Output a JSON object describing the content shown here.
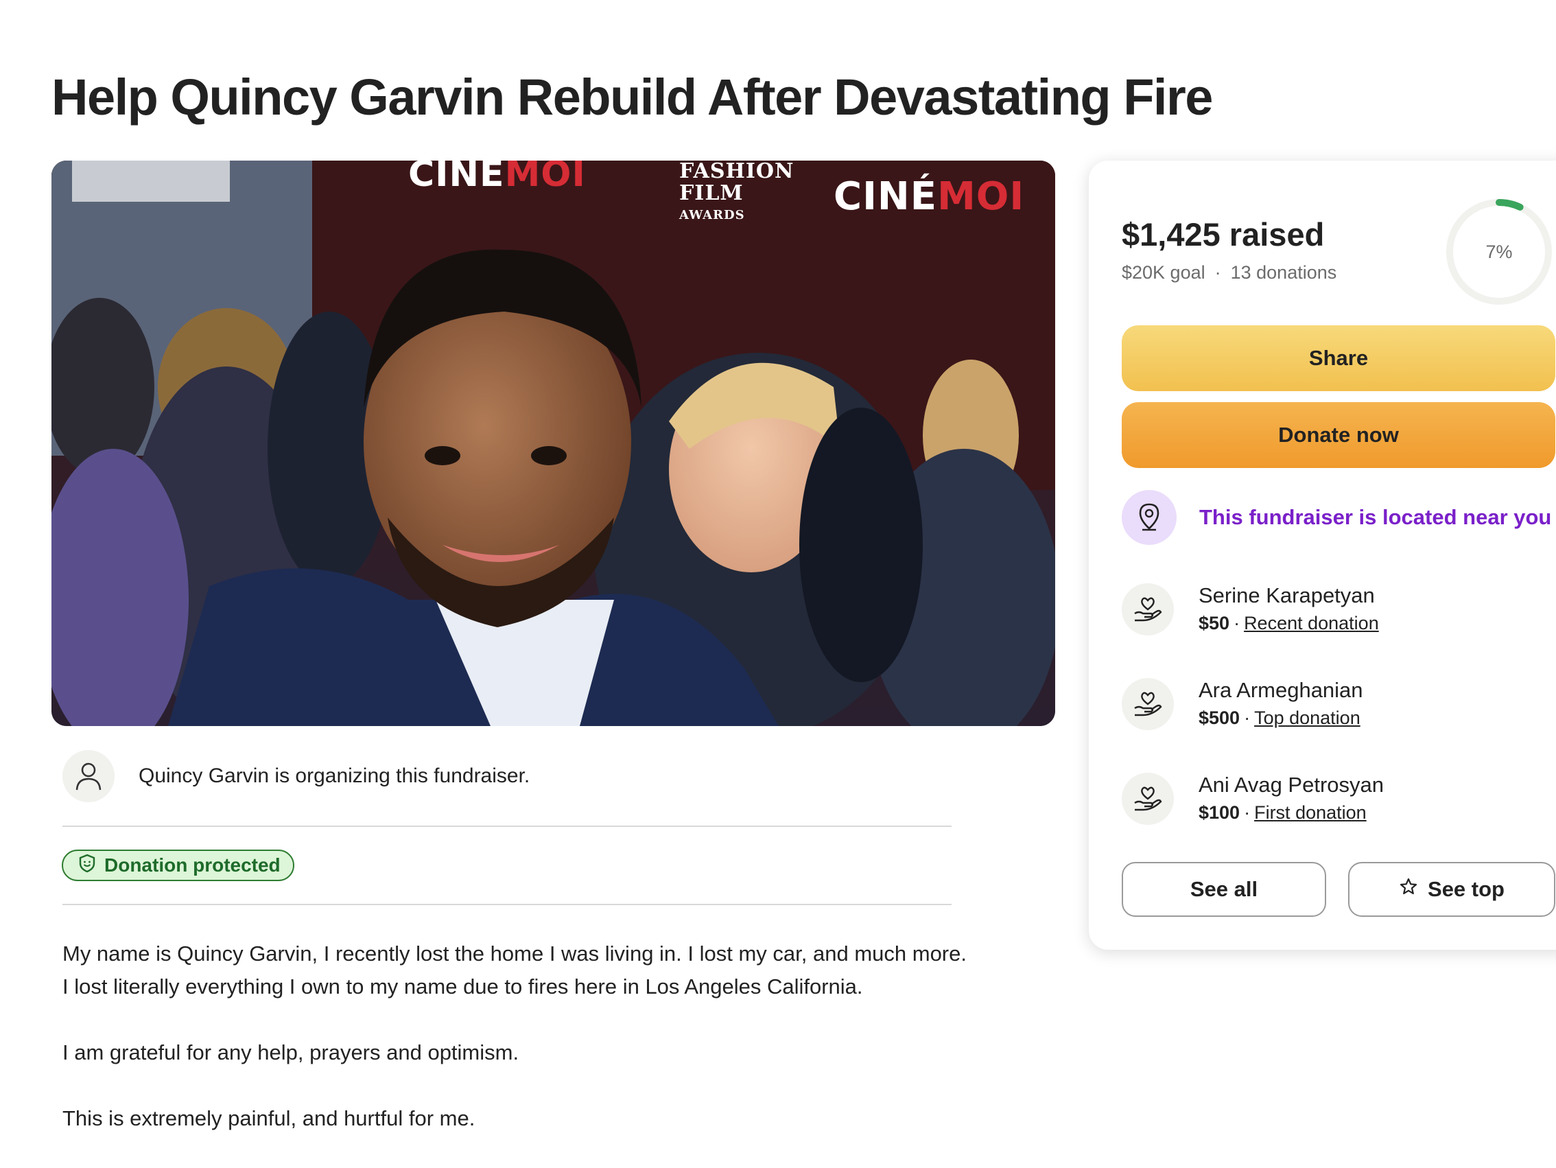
{
  "title": "Help Quincy Garvin Rebuild After Devastating Fire",
  "hero": {
    "backdrop_text_1": "CINE",
    "backdrop_text_1b": "MOI",
    "backdrop_text_2": "CINÉ",
    "backdrop_text_2b": "MOI",
    "backdrop_text_3": "FASHION",
    "backdrop_text_4": "FILM",
    "backdrop_text_5": "AWARDS"
  },
  "organizer": {
    "text": "Quincy Garvin is organizing this fundraiser.",
    "icon": "user-icon"
  },
  "badge": {
    "label": "Donation protected",
    "icon": "shield-icon",
    "color": "#2e7d32"
  },
  "story": [
    "My name is Quincy Garvin, I recently lost the home I was living in. I lost my car, and much more. I lost literally everything I own to my name due to fires here in Los Angeles California.",
    "I am grateful for any help, prayers and optimism.",
    "This is extremely painful, and hurtful for me."
  ],
  "summary": {
    "raised": "$1,425 raised",
    "goal": "$20K goal",
    "donations": "13 donations",
    "progress_percent": 7,
    "progress_label": "7%",
    "accent_color": "#3aa55c"
  },
  "buttons": {
    "share": "Share",
    "donate": "Donate now",
    "see_all": "See all",
    "see_top": "See top"
  },
  "location_notice": {
    "text": "This fundraiser is located near you",
    "icon": "map-pin-icon",
    "color": "#7a20c9"
  },
  "donors": [
    {
      "name": "Serine Karapetyan",
      "amount": "$50",
      "tag": "Recent donation"
    },
    {
      "name": "Ara Armeghanian",
      "amount": "$500",
      "tag": "Top donation"
    },
    {
      "name": "Ani Avag Petrosyan",
      "amount": "$100",
      "tag": "First donation"
    }
  ]
}
